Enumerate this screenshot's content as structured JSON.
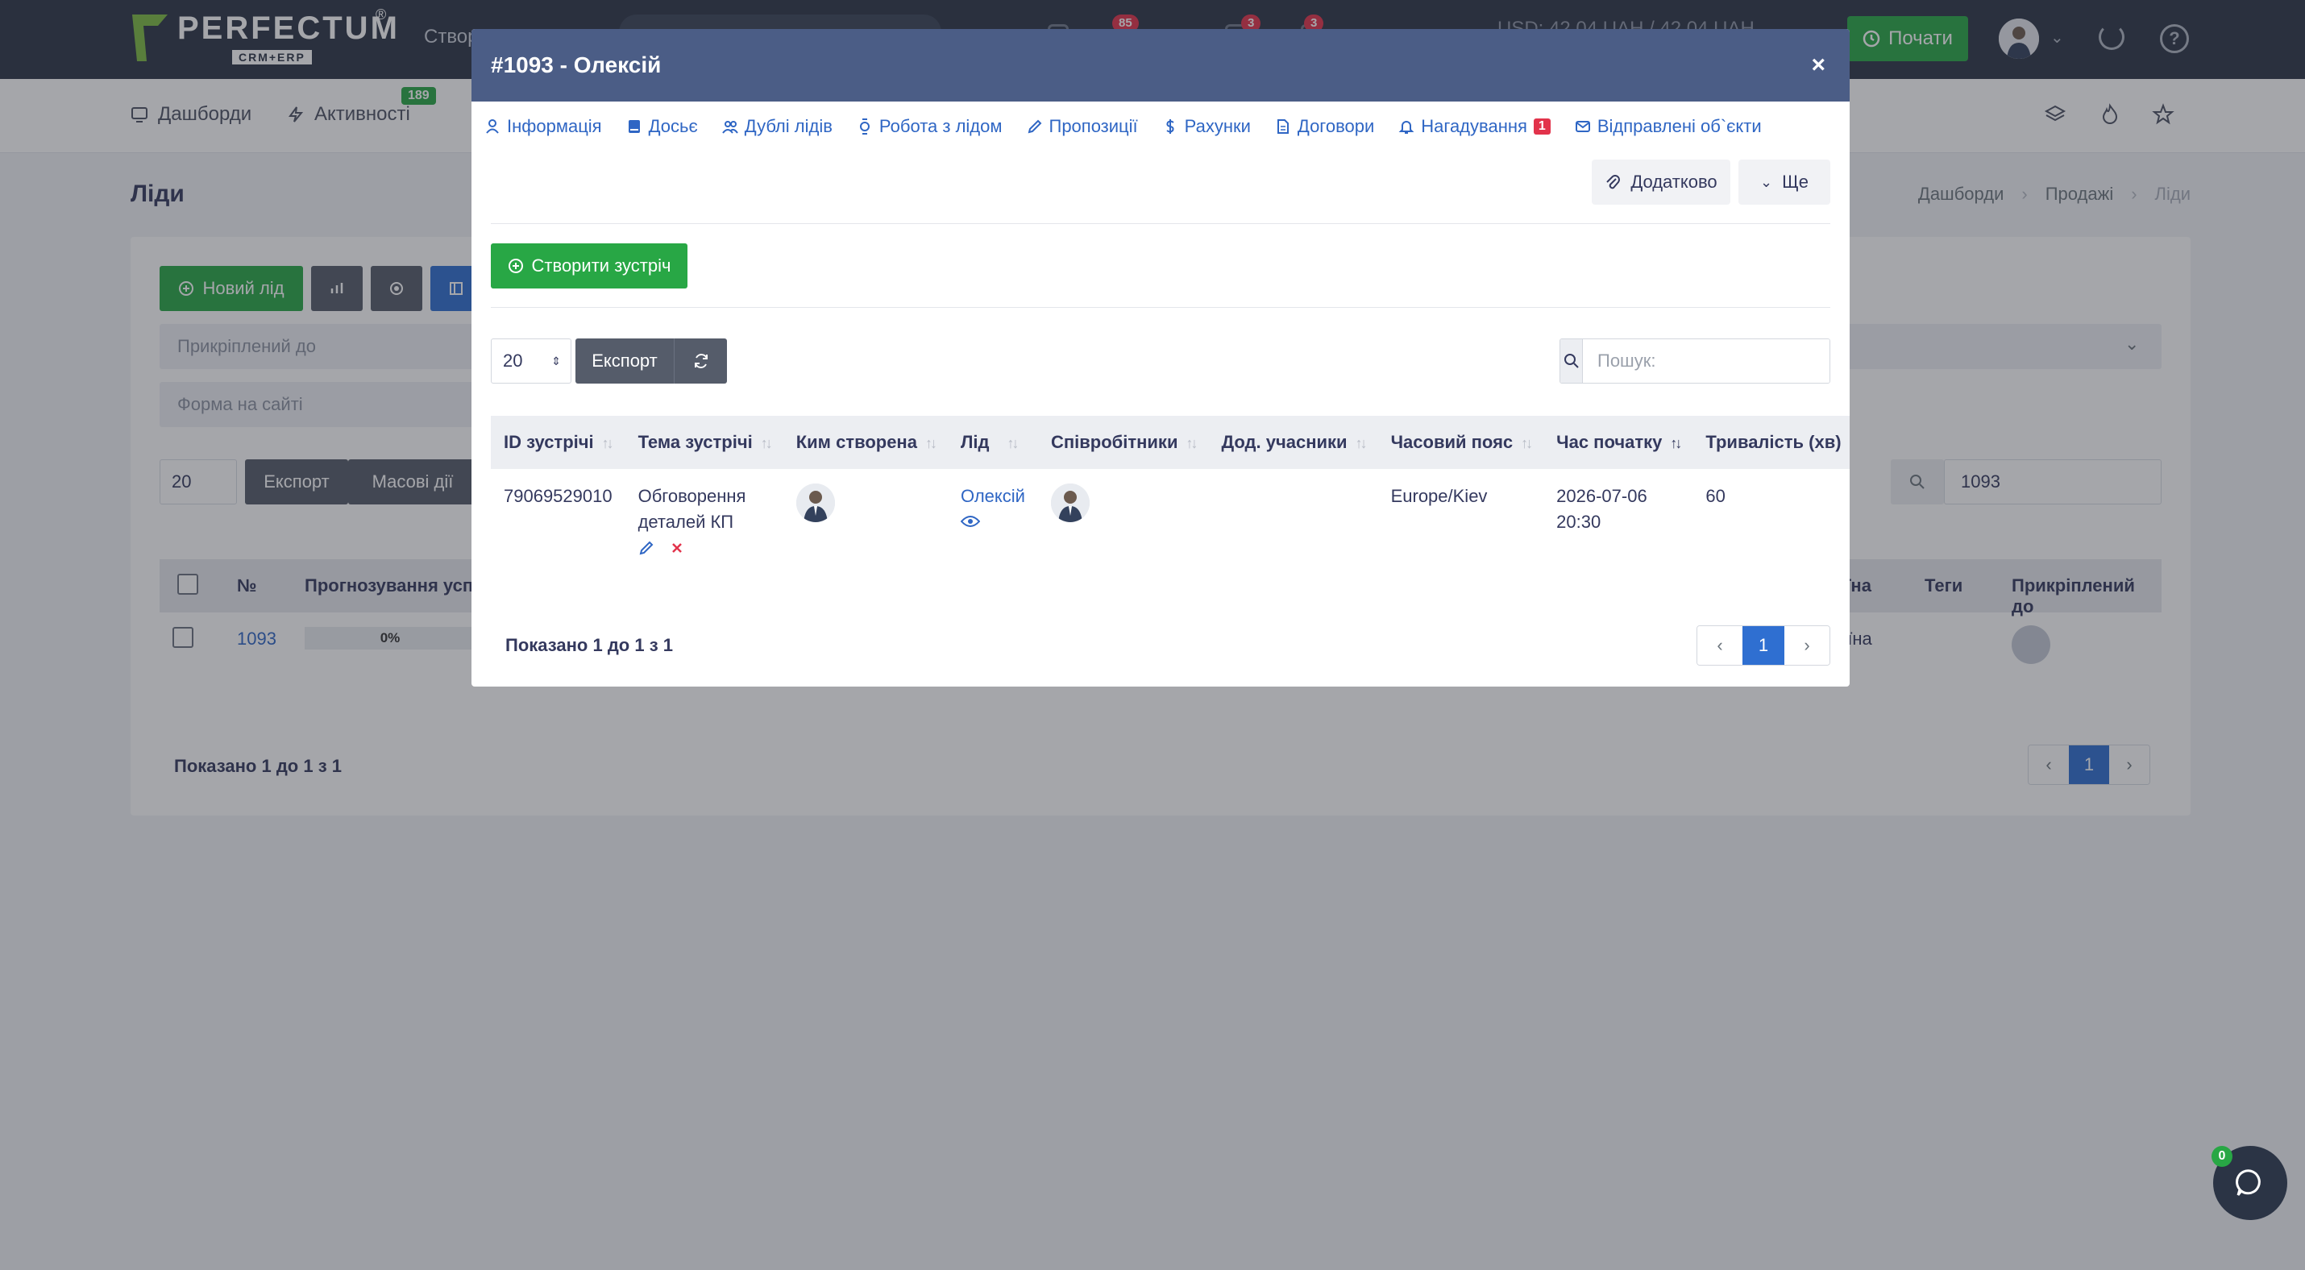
{
  "topbar": {
    "logo_name": "PERFECTUM",
    "logo_sub": "CRM+ERP",
    "logo_reg": "®",
    "create_label": "Створ",
    "badges": [
      "85",
      "3",
      "3"
    ],
    "rate": "USD: 42.04 UAH / 42.04 UAH",
    "start_button": "Почати"
  },
  "subnav": {
    "items": [
      {
        "label": "Дашборди",
        "icon": "monitor-icon"
      },
      {
        "label": "Активності",
        "icon": "bolt-icon"
      }
    ],
    "activity_badge": "189"
  },
  "page": {
    "title": "Ліди",
    "breadcrumbs": [
      "Дашборди",
      "Продажі",
      "Ліди"
    ]
  },
  "background": {
    "new_lead": "Новий лід",
    "attached_to": "Прикріплений до",
    "site_form": "Форма на сайті",
    "page_len": "20",
    "export": "Експорт",
    "bulk": "Масові дії",
    "search_value": "1093",
    "columns": [
      "№",
      "Прогнозування успіх",
      "аїна",
      "Теги",
      "Прикріплений до"
    ],
    "row": {
      "id": "1093",
      "progress": "0%",
      "progress_fraction": 0,
      "country": "аїна"
    },
    "shown": "Показано 1 до 1 з 1",
    "page": "1"
  },
  "modal": {
    "title": "#1093 - Олексій",
    "close": "×",
    "tabs": [
      {
        "label": "Інформація",
        "icon": "user-icon"
      },
      {
        "label": "Досьє",
        "icon": "book-icon"
      },
      {
        "label": "Дублі лідів",
        "icon": "users-icon"
      },
      {
        "label": "Робота з лідом",
        "icon": "watch-icon"
      },
      {
        "label": "Пропозиції",
        "icon": "pencil-icon"
      },
      {
        "label": "Рахунки",
        "icon": "dollar-icon"
      },
      {
        "label": "Договори",
        "icon": "document-icon"
      },
      {
        "label": "Нагадування",
        "icon": "bell-icon",
        "badge": "1"
      },
      {
        "label": "Відправлені об`єкти",
        "icon": "envelope-icon"
      }
    ],
    "more_button": "Додатково",
    "extra_button": "Ще",
    "create_meeting": "Створити зустріч",
    "page_len": "20",
    "export": "Експорт",
    "search_placeholder": "Пошук:",
    "columns": [
      "ID зустрічі",
      "Тема зустрічі",
      "Ким створена",
      "Лід",
      "Співробітники",
      "Дод. учасники",
      "Часовий пояс",
      "Час початку",
      "Тривалість (хв)"
    ],
    "rows": [
      {
        "id": "79069529010",
        "topic": "Обговорення деталей КП",
        "lead": "Олексій",
        "extra": "",
        "timezone": "Europe/Kiev",
        "start": "2026-07-06 20:30",
        "duration": "60"
      }
    ],
    "shown": "Показано 1 до 1 з 1",
    "page": "1",
    "prev": "‹",
    "next": "›"
  },
  "chat": {
    "badge": "0"
  },
  "colors": {
    "primary": "#2f6fd1",
    "success": "#28a745",
    "modal_header": "#4b5d86",
    "navbar": "#2b3445",
    "danger": "#e2334b"
  }
}
